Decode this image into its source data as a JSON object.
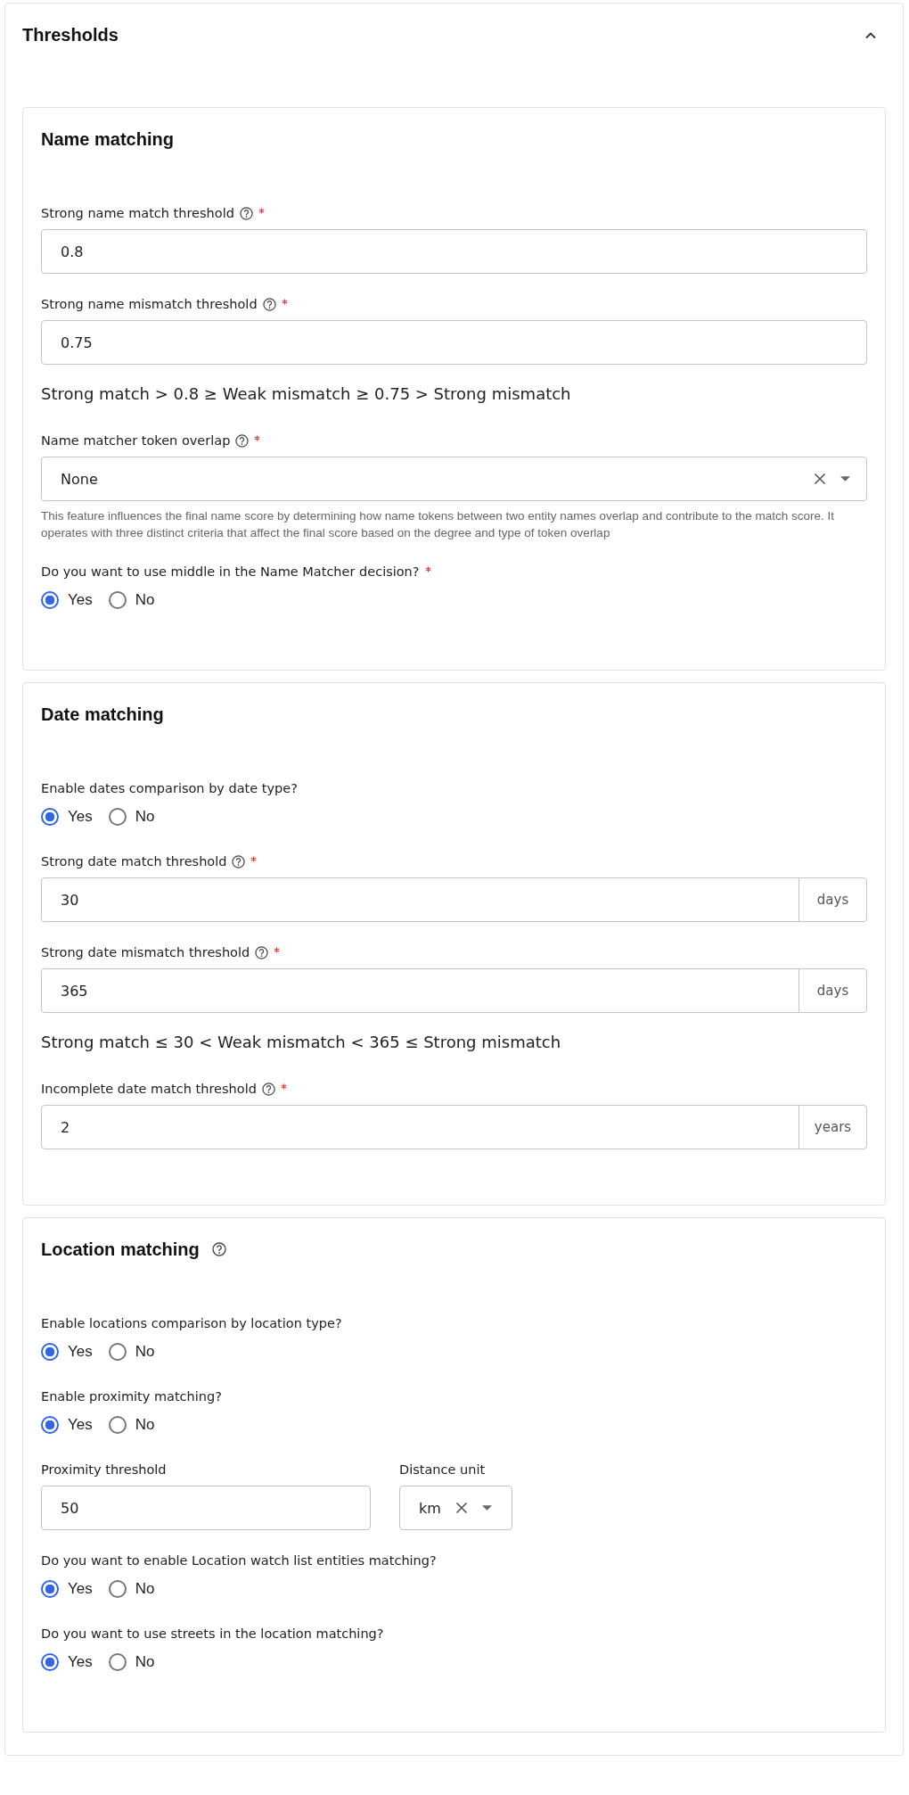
{
  "panel": {
    "title": "Thresholds",
    "expanded": true
  },
  "sections": [
    {
      "title": "Name matching",
      "help": false,
      "fields": [
        {
          "kind": "input",
          "label": "Strong name match threshold",
          "help": true,
          "required": true,
          "value": "0.8"
        },
        {
          "kind": "input",
          "label": "Strong name mismatch threshold",
          "help": true,
          "required": true,
          "value": "0.75"
        },
        {
          "kind": "summary",
          "text": "Strong match > 0.8 ≥ Weak mismatch ≥ 0.75 > Strong mismatch"
        },
        {
          "kind": "select",
          "label": "Name matcher token overlap",
          "help": true,
          "required": true,
          "value": "None",
          "hint": "This feature influences the final name score by determining how name tokens between two entity names overlap and contribute to the match score. It operates with three distinct criteria that affect the final score based on the degree and type of token overlap"
        },
        {
          "kind": "radio",
          "label": "Do you want to use middle in the Name Matcher decision?",
          "help": false,
          "required": true,
          "options": [
            {
              "label": "Yes",
              "selected": true
            },
            {
              "label": "No",
              "selected": false
            }
          ]
        }
      ]
    },
    {
      "title": "Date matching",
      "help": false,
      "fields": [
        {
          "kind": "radio",
          "label": "Enable dates comparison by date type?",
          "help": false,
          "required": false,
          "options": [
            {
              "label": "Yes",
              "selected": true
            },
            {
              "label": "No",
              "selected": false
            }
          ]
        },
        {
          "kind": "input",
          "label": "Strong date match threshold",
          "help": true,
          "required": true,
          "value": "30",
          "unit": "days"
        },
        {
          "kind": "input",
          "label": "Strong date mismatch threshold",
          "help": true,
          "required": true,
          "value": "365",
          "unit": "days"
        },
        {
          "kind": "summary",
          "text": "Strong match ≤ 30 < Weak mismatch < 365 ≤  Strong mismatch"
        },
        {
          "kind": "input",
          "label": "Incomplete date match threshold",
          "help": true,
          "required": true,
          "value": "2",
          "unit": "years"
        }
      ]
    },
    {
      "title": "Location matching",
      "help": true,
      "fields": [
        {
          "kind": "radio",
          "label": "Enable locations comparison by location type?",
          "help": false,
          "required": false,
          "options": [
            {
              "label": "Yes",
              "selected": true
            },
            {
              "label": "No",
              "selected": false
            }
          ]
        },
        {
          "kind": "radio",
          "label": "Enable proximity matching?",
          "help": false,
          "required": false,
          "options": [
            {
              "label": "Yes",
              "selected": true
            },
            {
              "label": "No",
              "selected": false
            }
          ]
        },
        {
          "kind": "row",
          "fields": [
            {
              "kind": "input",
              "label": "Proximity threshold",
              "help": false,
              "required": false,
              "value": "50"
            },
            {
              "kind": "select",
              "label": "Distance unit",
              "help": false,
              "required": false,
              "value": "km"
            }
          ]
        },
        {
          "kind": "radio",
          "label": "Do you want to enable Location watch list entities matching?",
          "help": false,
          "required": false,
          "options": [
            {
              "label": "Yes",
              "selected": true
            },
            {
              "label": "No",
              "selected": false
            }
          ]
        },
        {
          "kind": "radio",
          "label": "Do you want to use streets in the location matching?",
          "help": false,
          "required": false,
          "options": [
            {
              "label": "Yes",
              "selected": true
            },
            {
              "label": "No",
              "selected": false
            }
          ]
        }
      ]
    }
  ]
}
